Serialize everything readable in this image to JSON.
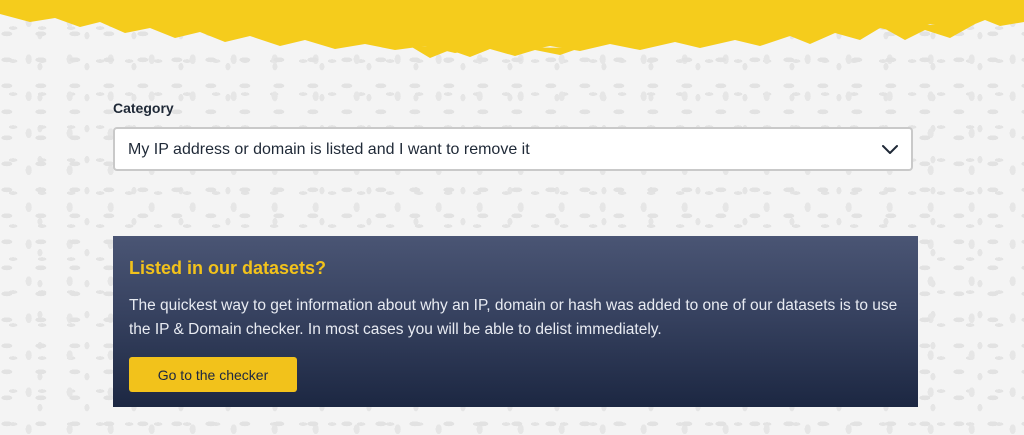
{
  "colors": {
    "accent_yellow": "#f2c21b",
    "panel_top": "#4a5574",
    "panel_bottom": "#1c2742",
    "text_dark": "#1f2937"
  },
  "form": {
    "category_label": "Category",
    "category_selected": "My IP address or domain is listed and I want to remove it",
    "chevron_icon": "chevron-down-icon"
  },
  "info_panel": {
    "title": "Listed in our datasets?",
    "body": "The quickest way to get information about why an IP, domain or hash was added to one of our datasets is to use the IP & Domain checker. In most cases you will be able to delist immediately.",
    "button_label": "Go to the checker"
  }
}
